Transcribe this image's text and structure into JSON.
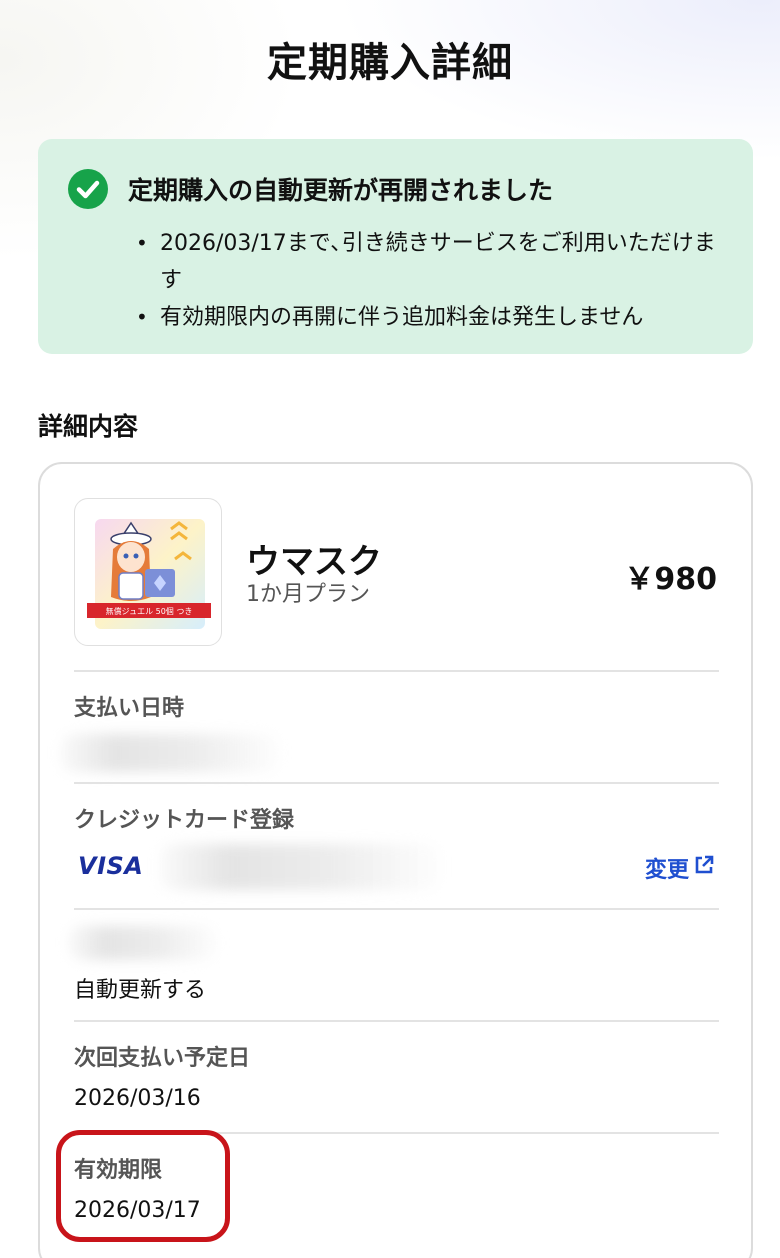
{
  "header": {
    "title": "定期購入詳細"
  },
  "banner": {
    "title": "定期購入の自動更新が再開されました",
    "items": [
      "2026/03/17まで､引き続きサービスをご利用いただけます",
      "有効期限内の再開に伴う追加料金は発生しません"
    ]
  },
  "details": {
    "heading": "詳細内容",
    "product": {
      "name": "ウマスク",
      "plan": "1か月プラン",
      "price": "￥980",
      "thumb_caption": "無償ジュエル 50個 つき"
    },
    "payment_date": {
      "label": "支払い日時"
    },
    "credit_card": {
      "label": "クレジットカード登録",
      "brand": "VISA",
      "change_label": "変更"
    },
    "auto_renew": {
      "value": "自動更新する"
    },
    "next_payment": {
      "label": "次回支払い予定日",
      "value": "2026/03/16"
    },
    "expiry": {
      "label": "有効期限",
      "value": "2026/03/17"
    }
  },
  "colors": {
    "banner_bg": "#d9f2e4",
    "success": "#17a34a",
    "link": "#1f4fd0",
    "visa": "#1a2f9c",
    "highlight": "#c8141a"
  },
  "icons": [
    "check-circle-icon",
    "external-link-icon"
  ]
}
